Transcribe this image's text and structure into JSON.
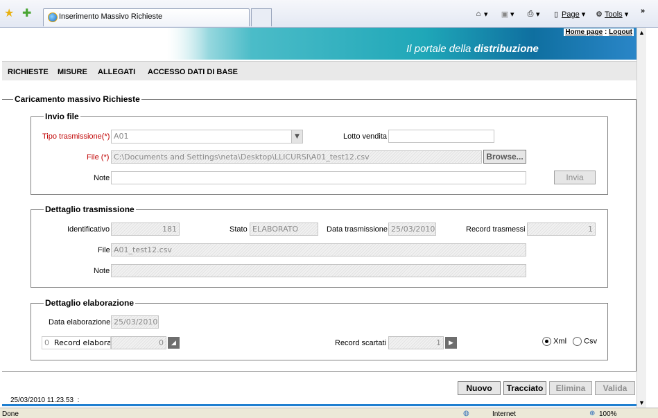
{
  "browser": {
    "tab_title": "Inserimento Massivo Richieste",
    "page_menu": "Page",
    "tools_menu": "Tools",
    "overflow": "»"
  },
  "banner": {
    "home_link": "Home page",
    "sep": ":",
    "logout_link": "Logout",
    "title_light": "Il portale della ",
    "title_bold": "distribuzione"
  },
  "menu": [
    "RICHIESTE",
    "MISURE",
    "ALLEGATI",
    "ACCESSO DATI DI BASE"
  ],
  "main_legend": "Caricamento massivo Richieste",
  "invio": {
    "legend": "Invio file",
    "tipo_label": "Tipo trasmissione(*)",
    "tipo_value": "A01",
    "lotto_label": "Lotto vendita",
    "lotto_value": "",
    "file_label": "File (*)",
    "file_value": "C:\\Documents and Settings\\neta\\Desktop\\LLICURSI\\A01_test12.csv",
    "browse_label": "Browse...",
    "note_label": "Note",
    "note_value": "",
    "invia_label": "Invia"
  },
  "trasmissione": {
    "legend": "Dettaglio trasmissione",
    "id_label": "Identificativo",
    "id_value": "181",
    "stato_label": "Stato",
    "stato_value": "ELABORATO",
    "data_label": "Data trasmissione",
    "data_value": "25/03/2010",
    "record_label": "Record trasmessi",
    "record_value": "1",
    "file_label": "File",
    "file_value": "A01_test12.csv",
    "note_label": "Note",
    "note_value": ""
  },
  "elaborazione": {
    "legend": "Dettaglio elaborazione",
    "data_label": "Data elaborazione",
    "data_value": "25/03/2010",
    "prefix_value": "0",
    "elaborati_label": "Record elaborati",
    "elaborati_value": "0",
    "scartati_label": "Record scartati",
    "scartati_value": "1",
    "xml_label": "Xml",
    "csv_label": "Csv",
    "selected_format": "Xml"
  },
  "actions": {
    "nuovo": "Nuovo",
    "tracciato": "Tracciato",
    "elimina": "Elimina",
    "valida": "Valida"
  },
  "footer_timestamp": "25/03/2010 11.23.53",
  "footer_sep": ":",
  "status": {
    "left": "Done",
    "zone": "Internet",
    "zoom": "100%"
  },
  "colors": {
    "required_label": "#c00000",
    "menu_bg": "#e9e9e9",
    "banner_accent": "#1fa7b8"
  }
}
